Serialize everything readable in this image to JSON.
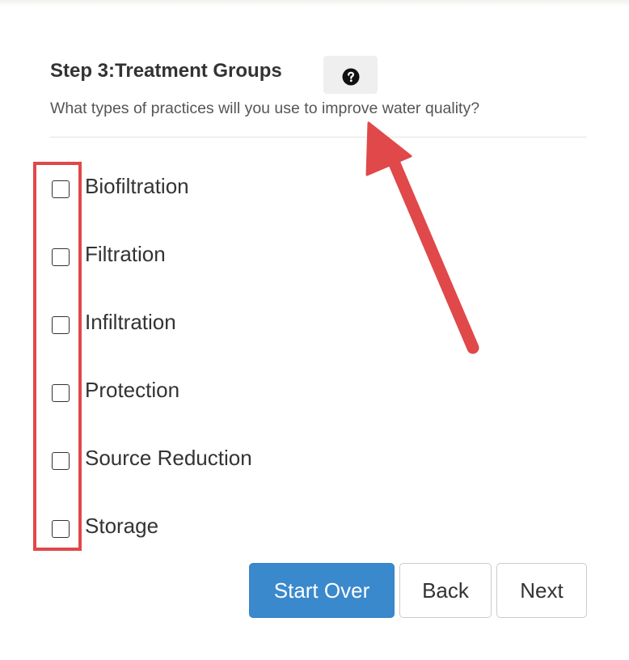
{
  "step": {
    "title": "Step 3:Treatment Groups",
    "subtitle": "What types of practices will you use to improve water quality?",
    "help_icon": "question-circle-icon"
  },
  "options": [
    {
      "label": "Biofiltration",
      "checked": false
    },
    {
      "label": "Filtration",
      "checked": false
    },
    {
      "label": "Infiltration",
      "checked": false
    },
    {
      "label": "Protection",
      "checked": false
    },
    {
      "label": "Source Reduction",
      "checked": false
    },
    {
      "label": "Storage",
      "checked": false
    }
  ],
  "buttons": {
    "start_over": "Start Over",
    "back": "Back",
    "next": "Next"
  },
  "colors": {
    "primary": "#3a89cc",
    "annotation": "#e0484a"
  }
}
